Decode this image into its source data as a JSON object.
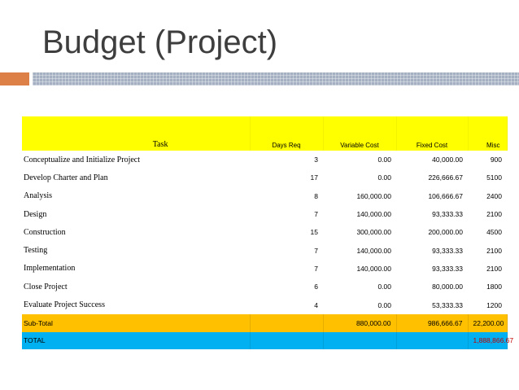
{
  "slide": {
    "title": "Budget (Project)"
  },
  "table": {
    "headers": {
      "task": "Task",
      "days_req": "Days Req",
      "variable_cost": "Variable Cost",
      "fixed_cost": "Fixed Cost",
      "misc": "Misc"
    },
    "rows": [
      {
        "task": "Conceptualize and Initialize Project",
        "days": "3",
        "variable": "0.00",
        "fixed": "40,000.00",
        "misc": "900"
      },
      {
        "task": "Develop Charter and Plan",
        "days": "17",
        "variable": "0.00",
        "fixed": "226,666.67",
        "misc": "5100"
      },
      {
        "task": "Analysis",
        "days": "8",
        "variable": "160,000.00",
        "fixed": "106,666.67",
        "misc": "2400"
      },
      {
        "task": "Design",
        "days": "7",
        "variable": "140,000.00",
        "fixed": "93,333.33",
        "misc": "2100"
      },
      {
        "task": "Construction",
        "days": "15",
        "variable": "300,000.00",
        "fixed": "200,000.00",
        "misc": "4500"
      },
      {
        "task": "Testing",
        "days": "7",
        "variable": "140,000.00",
        "fixed": "93,333.33",
        "misc": "2100"
      },
      {
        "task": "Implementation",
        "days": "7",
        "variable": "140,000.00",
        "fixed": "93,333.33",
        "misc": "2100"
      },
      {
        "task": "Close Project",
        "days": "6",
        "variable": "0.00",
        "fixed": "80,000.00",
        "misc": "1800"
      },
      {
        "task": "Evaluate Project Success",
        "days": "4",
        "variable": "0.00",
        "fixed": "53,333.33",
        "misc": "1200"
      }
    ],
    "subtotal": {
      "label": "Sub-Total",
      "variable": "880,000.00",
      "fixed": "986,666.67",
      "misc": "22,200.00"
    },
    "total": {
      "label": "TOTAL",
      "value": "1,888,866.67"
    }
  },
  "colors": {
    "header_bg": "#ffff00",
    "subtotal_bg": "#ffc000",
    "total_bg": "#00b0f0",
    "total_value": "#c00000",
    "accent_orange": "#dd8047",
    "accent_gray": "#a5b0c2"
  }
}
